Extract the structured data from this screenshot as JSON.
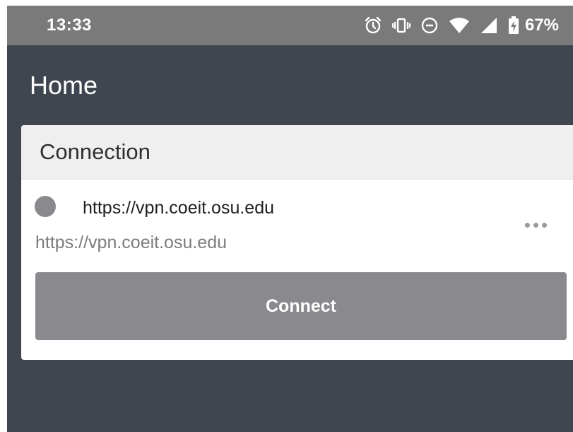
{
  "status_bar": {
    "time": "13:33",
    "battery_percent": "67%",
    "icons": [
      "alarm-icon",
      "vibrate-icon",
      "do-not-disturb-icon",
      "wifi-icon",
      "cell-signal-icon",
      "battery-charging-icon"
    ]
  },
  "app": {
    "title": "Home"
  },
  "card": {
    "header": "Connection",
    "connection_name": "https://vpn.coeit.osu.edu",
    "connection_url": "https://vpn.coeit.osu.edu",
    "more_label": "•••",
    "connect_label": "Connect"
  },
  "colors": {
    "status_bar_bg": "#7a7a7a",
    "app_bg": "#404650",
    "card_header_bg": "#efefef",
    "button_bg": "#8a8a8e",
    "status_dot": "#8a8a8e"
  }
}
